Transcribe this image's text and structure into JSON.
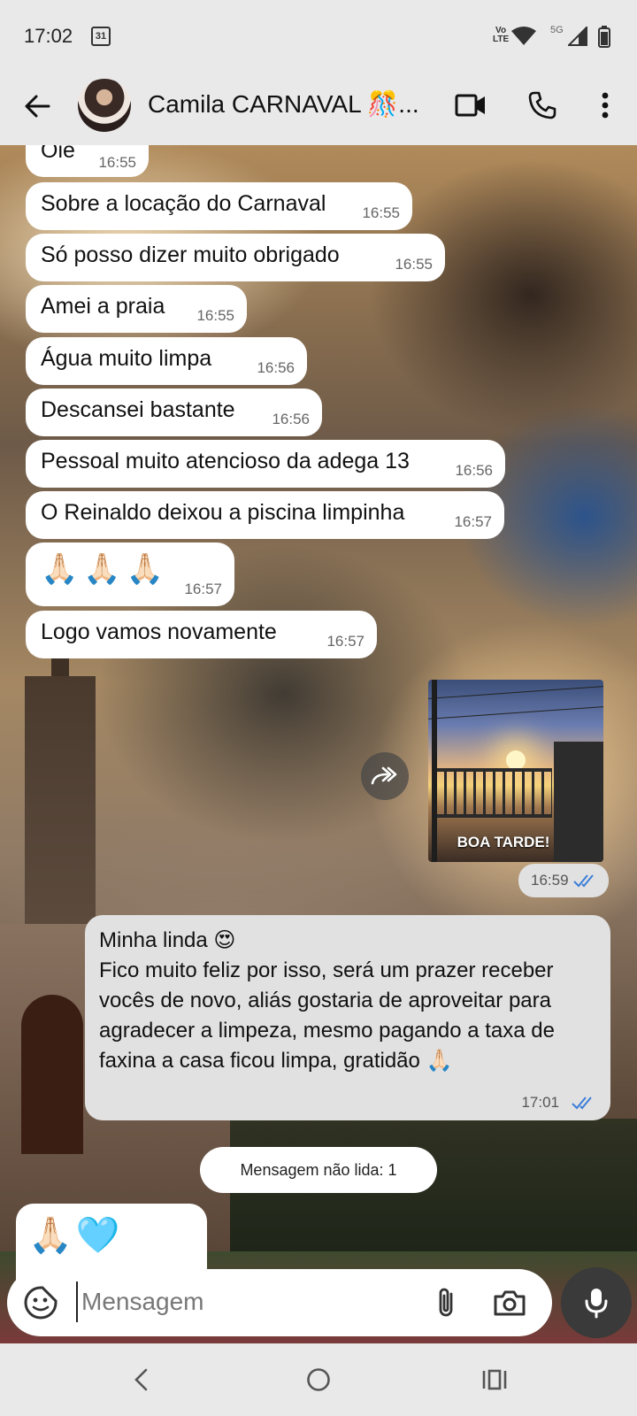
{
  "status_bar": {
    "time": "17:02",
    "calendar_day": "31",
    "volte": "Vo LTE",
    "network": "5G"
  },
  "header": {
    "contact_name": "Camila CARNAVAL 🎊..."
  },
  "messages_in": [
    {
      "text": "Oie",
      "time": "16:55"
    },
    {
      "text": "Sobre a locação do Carnaval",
      "time": "16:55"
    },
    {
      "text": "Só posso dizer muito obrigado",
      "time": "16:55"
    },
    {
      "text": "Amei a praia",
      "time": "16:55"
    },
    {
      "text": "Água muito limpa",
      "time": "16:56"
    },
    {
      "text": "Descansei bastante",
      "time": "16:56"
    },
    {
      "text": "Pessoal muito atencioso da adega 13",
      "time": "16:56"
    },
    {
      "text": "O Reinaldo deixou a piscina limpinha",
      "time": "16:57"
    },
    {
      "text": "🙏🏻🙏🏻🙏🏻",
      "time": "16:57"
    },
    {
      "text": "Logo vamos novamente",
      "time": "16:57"
    }
  ],
  "image_message": {
    "caption": "BOA TARDE!",
    "time": "16:59"
  },
  "reply_message": {
    "line1": "Minha linda 😍",
    "body": "Fico muito feliz por isso, será um prazer receber vocês de novo, aliás gostaria de aproveitar para agradecer a limpeza, mesmo pagando a taxa de faxina a casa ficou limpa, gratidão 🙏🏻",
    "time": "17:01"
  },
  "unread_banner": "Mensagem não lida: 1",
  "last_message": {
    "text": "🙏🏻🩵"
  },
  "input": {
    "placeholder": "Mensagem"
  },
  "colors": {
    "header_bg": "#e9e9e9",
    "incoming_bubble": "#ffffff",
    "outgoing_bubble": "#e1e1e1",
    "read_ticks": "#3b7dd8",
    "mic_button": "#3a3a3a"
  }
}
